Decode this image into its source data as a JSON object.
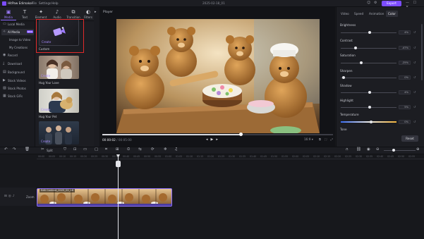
{
  "titlebar": {
    "app_name": "HitPaw Edimakor",
    "menus": [
      "File",
      "Settings",
      "Help"
    ],
    "doc_name": "2025-02-18_01",
    "export_label": "Export",
    "window_controls": "— ☐ ✕"
  },
  "media_tabs": [
    {
      "label": "Media",
      "icon": "media-icon",
      "glyph": "▣",
      "active": true
    },
    {
      "label": "Text",
      "icon": "text-icon",
      "glyph": "T",
      "active": false
    },
    {
      "label": "Element",
      "icon": "element-icon",
      "glyph": "✦",
      "active": false
    },
    {
      "label": "Audio",
      "icon": "audio-icon",
      "glyph": "♪",
      "active": false
    },
    {
      "label": "Transition",
      "icon": "transition-icon",
      "glyph": "⧉",
      "active": false
    },
    {
      "label": "Filters",
      "icon": "filters-icon",
      "glyph": "◐",
      "active": false
    }
  ],
  "sidebar": {
    "items": [
      {
        "label": "Local Media",
        "icon": "folder-icon",
        "glyph": "▭",
        "active": false,
        "sub": false
      },
      {
        "label": "AI Media",
        "icon": "ai-media-icon",
        "glyph": "✧",
        "active": true,
        "sub": false,
        "badge": "NEW"
      },
      {
        "label": "Image to Video",
        "icon": "",
        "glyph": "",
        "active": false,
        "sub": true
      },
      {
        "label": "My Creations",
        "icon": "",
        "glyph": "",
        "active": false,
        "sub": true
      },
      {
        "label": "Record",
        "icon": "record-icon",
        "glyph": "◉",
        "active": false,
        "sub": false
      },
      {
        "label": "Download",
        "icon": "download-icon",
        "glyph": "⤓",
        "active": false,
        "sub": false
      },
      {
        "label": "Background",
        "icon": "background-icon",
        "glyph": "▤",
        "active": false,
        "sub": false
      },
      {
        "label": "Stock Videos",
        "icon": "stock-videos-icon",
        "glyph": "▶",
        "active": false,
        "sub": false
      },
      {
        "label": "Stock Photos",
        "icon": "stock-photos-icon",
        "glyph": "▨",
        "active": false,
        "sub": false
      },
      {
        "label": "Stock GIFs",
        "icon": "stock-gifs-icon",
        "glyph": "▦",
        "active": false,
        "sub": false
      }
    ]
  },
  "media_panel": {
    "items": [
      {
        "label": "Custom",
        "tag": "Create"
      },
      {
        "label": "Hug Your Love",
        "tag": "Create"
      },
      {
        "label": "Hug Your Pet",
        "tag": "Create"
      },
      {
        "label": "",
        "tag": "Create"
      }
    ]
  },
  "player": {
    "title": "Player",
    "time_current": "00:00:02",
    "time_separator": " / ",
    "time_duration": "00:05:00",
    "progress": 0.6,
    "quality": "16:9 ▾",
    "right_icons": "⧉ ⛶ ⤢"
  },
  "props": {
    "tabs": [
      {
        "label": "Video",
        "active": false
      },
      {
        "label": "Speed",
        "active": false
      },
      {
        "label": "Animation",
        "active": false
      },
      {
        "label": "Color",
        "active": true
      }
    ],
    "adjustments": [
      {
        "label": "Brightness",
        "value": "4%",
        "level": 0.52
      },
      {
        "label": "Contrast",
        "value": "-47%",
        "level": 0.27
      },
      {
        "label": "Saturation",
        "value": "-25%",
        "level": 0.37
      },
      {
        "label": "Sharpen",
        "value": "0%",
        "level": 0.05
      },
      {
        "label": "Shadow",
        "value": "4%",
        "level": 0.52
      },
      {
        "label": "Highlight",
        "value": "5%",
        "level": 0.52
      },
      {
        "label": "Temperature",
        "value": "0%",
        "level": 0.55
      },
      {
        "label": "Tone",
        "value": "",
        "level": null
      }
    ],
    "reset_label": "Reset"
  },
  "timeline": {
    "split_label": "Split",
    "track_name": "Zoom",
    "clip_label": "Edit Content_2025_02_18",
    "ruler_ticks": [
      "00:00",
      "00:05",
      "00:10",
      "00:15",
      "00:20",
      "00:25",
      "00:30",
      "00:35",
      "00:40",
      "00:45",
      "00:50",
      "00:55",
      "01:00",
      "01:05",
      "01:10",
      "01:15",
      "01:20",
      "01:25",
      "01:30",
      "01:35",
      "01:40",
      "01:45",
      "01:50",
      "01:55",
      "02:00",
      "02:05",
      "02:10",
      "02:15",
      "02:20",
      "02:25",
      "02:30",
      "02:35",
      "02:40",
      "02:45",
      "02:50",
      "02:55",
      "03:00"
    ]
  }
}
